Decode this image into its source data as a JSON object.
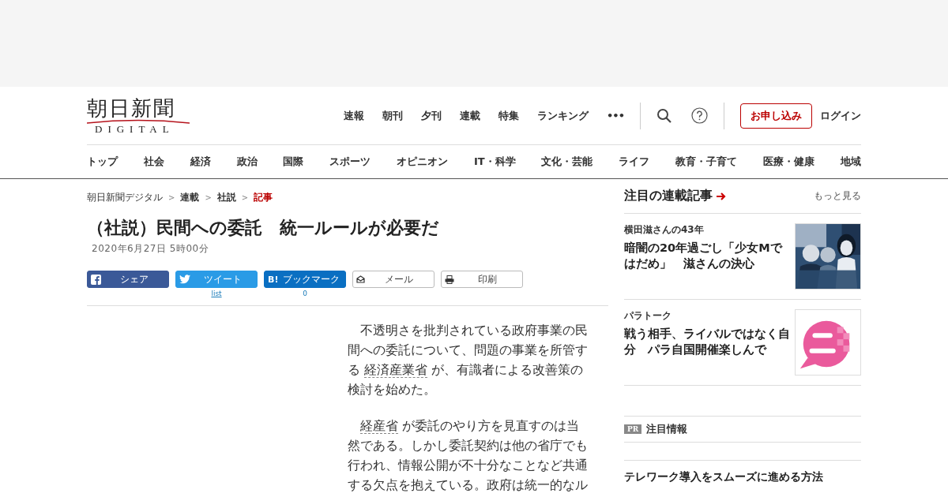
{
  "logo": {
    "title": "朝日新聞",
    "subtitle": "DIGITAL"
  },
  "top_nav": [
    "速報",
    "朝刊",
    "夕刊",
    "連載",
    "特集",
    "ランキング"
  ],
  "more_icon": "•••",
  "subscribe_button": "お申し込み",
  "login_link": "ログイン",
  "category_nav": [
    "トップ",
    "社会",
    "経済",
    "政治",
    "国際",
    "スポーツ",
    "オピニオン",
    "IT・科学",
    "文化・芸能",
    "ライフ",
    "教育・子育て",
    "医療・健康",
    "地域"
  ],
  "breadcrumb": [
    {
      "label": "朝日新聞デジタル",
      "selected": false
    },
    {
      "label": "連載",
      "selected": false
    },
    {
      "label": "社説",
      "selected": false
    },
    {
      "label": "記事",
      "selected": true
    }
  ],
  "breadcrumb_separator": ">",
  "article": {
    "title": "（社説）民間への委託　統一ルールが必要だ",
    "date": "2020年6月27日 5時00分",
    "share_buttons": [
      {
        "kind": "facebook",
        "label": "シェア"
      },
      {
        "kind": "twitter",
        "label": "ツイート",
        "count": "list"
      },
      {
        "kind": "hatena",
        "label": "ブックマーク",
        "icon_text": "B!",
        "count": "0"
      },
      {
        "kind": "mail",
        "label": "メール"
      },
      {
        "kind": "print",
        "label": "印刷"
      }
    ],
    "paragraphs": [
      [
        {
          "kind": "text",
          "text": "不透明さを批判されている政府事業の民間への委託について、問題の事業を所管する "
        },
        {
          "kind": "term",
          "text": "経済産業省"
        },
        {
          "kind": "text",
          "text": " が、有識者による改善策の検討を始めた。"
        }
      ],
      [
        {
          "kind": "term",
          "text": "経産省"
        },
        {
          "kind": "text",
          "text": " が委託のやり方を見直すのは当然である。しかし委託契約は他の省庁でも行われ、情報公開が不十分なことなど共通する欠点を抱えている。政府は統一的なル"
        }
      ]
    ]
  },
  "sidebar": {
    "heading": "注目の連載記事",
    "more_link": "もっと見る",
    "items": [
      {
        "series": "横田滋さんの43年",
        "title": "暗闇の20年過ごし「少女Mではだめ」　滋さんの決心"
      },
      {
        "series": "パラトーク",
        "title": "戦う相手、ライバルではなく自分　パラ自国開催楽しんで"
      }
    ],
    "pr": {
      "badge": "PR",
      "heading": "注目情報",
      "items": [
        {
          "title": "テレワーク導入をスムーズに進める方法"
        }
      ]
    }
  }
}
